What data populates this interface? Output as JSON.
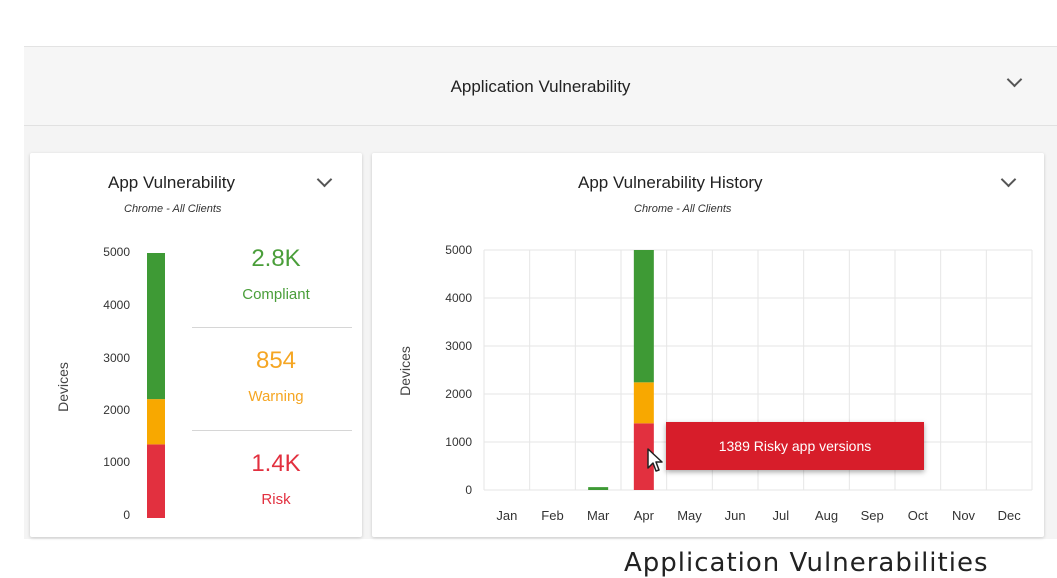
{
  "section": {
    "title": "Application Vulnerability"
  },
  "left_panel": {
    "title": "App Vulnerability",
    "subtitle": "Chrome - All Clients",
    "ylabel": "Devices",
    "stats": [
      {
        "value": "2.8K",
        "label": "Compliant",
        "color": "#4a9e3a"
      },
      {
        "value": "854",
        "label": "Warning",
        "color": "#f5a623"
      },
      {
        "value": "1.4K",
        "label": "Risk",
        "color": "#e2303f"
      }
    ]
  },
  "right_panel": {
    "title": "App Vulnerability History",
    "subtitle": "Chrome - All Clients",
    "tooltip": "1389 Risky app versions"
  },
  "caption": "Application Vulnerabilities",
  "colors": {
    "compliant": "#3e9a35",
    "warning": "#f8a800",
    "risk": "#e2303f",
    "accent": "#d71d2a"
  },
  "chart_data": [
    {
      "type": "bar",
      "title": "App Vulnerability",
      "subtitle": "Chrome - All Clients",
      "ylabel": "Devices",
      "ylim": [
        0,
        5000
      ],
      "yticks": [
        "0",
        "1000",
        "2000",
        "3000",
        "4000",
        "5000"
      ],
      "categories": [
        ""
      ],
      "stacked": true,
      "series": [
        {
          "name": "Risk",
          "values": [
            1389
          ]
        },
        {
          "name": "Warning",
          "values": [
            854
          ]
        },
        {
          "name": "Compliant",
          "values": [
            2757
          ]
        }
      ]
    },
    {
      "type": "bar",
      "title": "App Vulnerability History",
      "subtitle": "Chrome - All Clients",
      "ylabel": "Devices",
      "ylim": [
        0,
        5000
      ],
      "yticks": [
        "0",
        "1000",
        "2000",
        "3000",
        "4000",
        "5000"
      ],
      "categories": [
        "Jan",
        "Feb",
        "Mar",
        "Apr",
        "May",
        "Jun",
        "Jul",
        "Aug",
        "Sep",
        "Oct",
        "Nov",
        "Dec"
      ],
      "stacked": true,
      "grid": true,
      "series": [
        {
          "name": "Risk",
          "values": [
            0,
            0,
            0,
            1389,
            0,
            0,
            0,
            0,
            0,
            0,
            0,
            0
          ]
        },
        {
          "name": "Warning",
          "values": [
            0,
            0,
            0,
            854,
            0,
            0,
            0,
            0,
            0,
            0,
            0,
            0
          ]
        },
        {
          "name": "Compliant",
          "values": [
            0,
            0,
            60,
            2757,
            0,
            0,
            0,
            0,
            0,
            0,
            0,
            0
          ]
        }
      ]
    }
  ]
}
